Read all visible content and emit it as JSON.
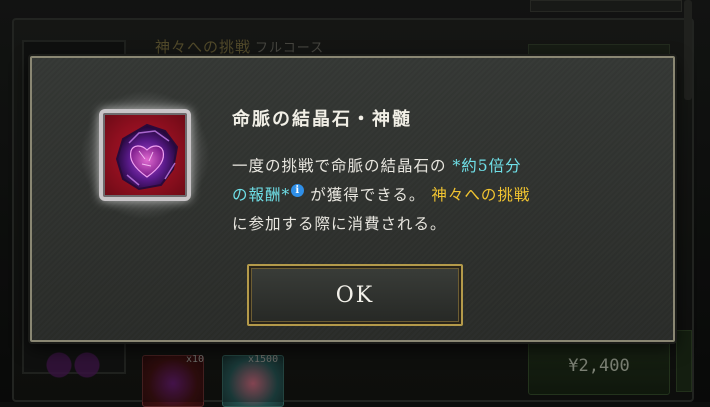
{
  "background": {
    "row_title": "神々への挑戦",
    "row_subtitle": "フルコース",
    "item_counts": [
      "x10",
      "x1500"
    ],
    "price_label": "¥2,400"
  },
  "dialog": {
    "item_name": "命脈の結晶石・神髄",
    "item_icon": "life-vein-crystal-icon",
    "description": {
      "line1_pre": "一度の挑戦で命脈の結晶石の",
      "line1_highlight": "*約5倍分",
      "line2_highlight": "の報酬*",
      "info_glyph": "i",
      "line2_mid": "が獲得できる。",
      "line2_event": "神々への挑戦",
      "line3": "に参加する際に消費される。"
    },
    "ok_label": "OK"
  },
  "colors": {
    "highlight_cyan": "#6fe0e8",
    "highlight_gold": "#f1c430",
    "button_border": "#b49a4a"
  }
}
